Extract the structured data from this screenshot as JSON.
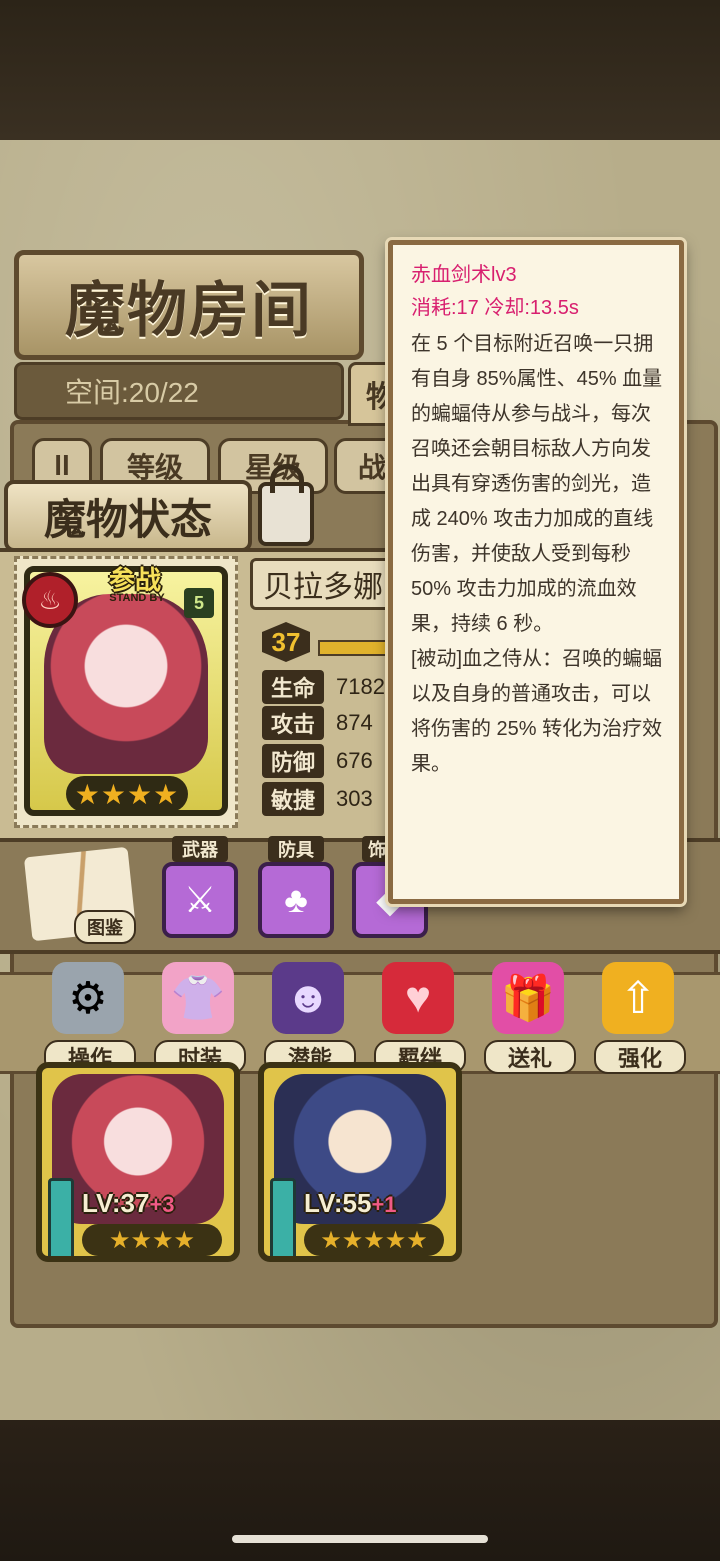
{
  "header": {
    "room_title": "魔物房间",
    "space_label": "空间:20/22",
    "active_tab_partial": "物"
  },
  "sort_bar": {
    "toggle_icon": "pause-icon",
    "buttons": [
      "等级",
      "星级",
      "战"
    ]
  },
  "status": {
    "title": "魔物状态",
    "lock_icon": "padlock-icon",
    "standby_text": "参战",
    "standby_sub": "STAND BY",
    "rank": "5",
    "element_icon": "fire-icon",
    "stars": "★★★★",
    "name": "贝拉多娜",
    "level": "37",
    "stats": [
      {
        "label": "生命",
        "value": "7182"
      },
      {
        "label": "攻击",
        "value": "874"
      },
      {
        "label": "防御",
        "value": "676"
      },
      {
        "label": "敏捷",
        "value": "303"
      }
    ]
  },
  "equipment": {
    "atlas_label": "图鉴",
    "slots": [
      {
        "tag": "武器",
        "icon": "weapon-icon"
      },
      {
        "tag": "防具",
        "icon": "armor-icon"
      },
      {
        "tag": "饰",
        "icon": "accessory-icon"
      }
    ]
  },
  "actions": [
    {
      "label": "操作",
      "icon": "gear-icon",
      "color": "#9aa4ad"
    },
    {
      "label": "时装",
      "icon": "costume-icon",
      "color": "#f2a3c7"
    },
    {
      "label": "潜能",
      "icon": "potential-icon",
      "color": "#5b3a8a"
    },
    {
      "label": "羁绊",
      "icon": "heart-icon",
      "color": "#d62a3a"
    },
    {
      "label": "送礼",
      "icon": "gift-icon",
      "color": "#e24ea6"
    },
    {
      "label": "强化",
      "icon": "upgrade-arrow-icon",
      "color": "#f0b020"
    }
  ],
  "cards": [
    {
      "level": "LV:37",
      "plus": "+3",
      "stars": "★★★★"
    },
    {
      "level": "LV:55",
      "plus": "+1",
      "stars": "★★★★★"
    }
  ],
  "tooltip": {
    "title": "赤血剑术lv3",
    "cost": "消耗:17 冷却:13.5s",
    "description": "在 5 个目标附近召唤一只拥有自身 85%属性、45% 血量的蝙蝠侍从参与战斗，每次召唤还会朝目标敌人方向发出具有穿透伤害的剑光，造成 240% 攻击力加成的直线伤害，并使敌人受到每秒 50% 攻击力加成的流血效果，持续 6 秒。",
    "passive": "[被动]血之侍从：召唤的蝙蝠以及自身的普通攻击，可以将伤害的 25% 转化为治疗效果。"
  }
}
